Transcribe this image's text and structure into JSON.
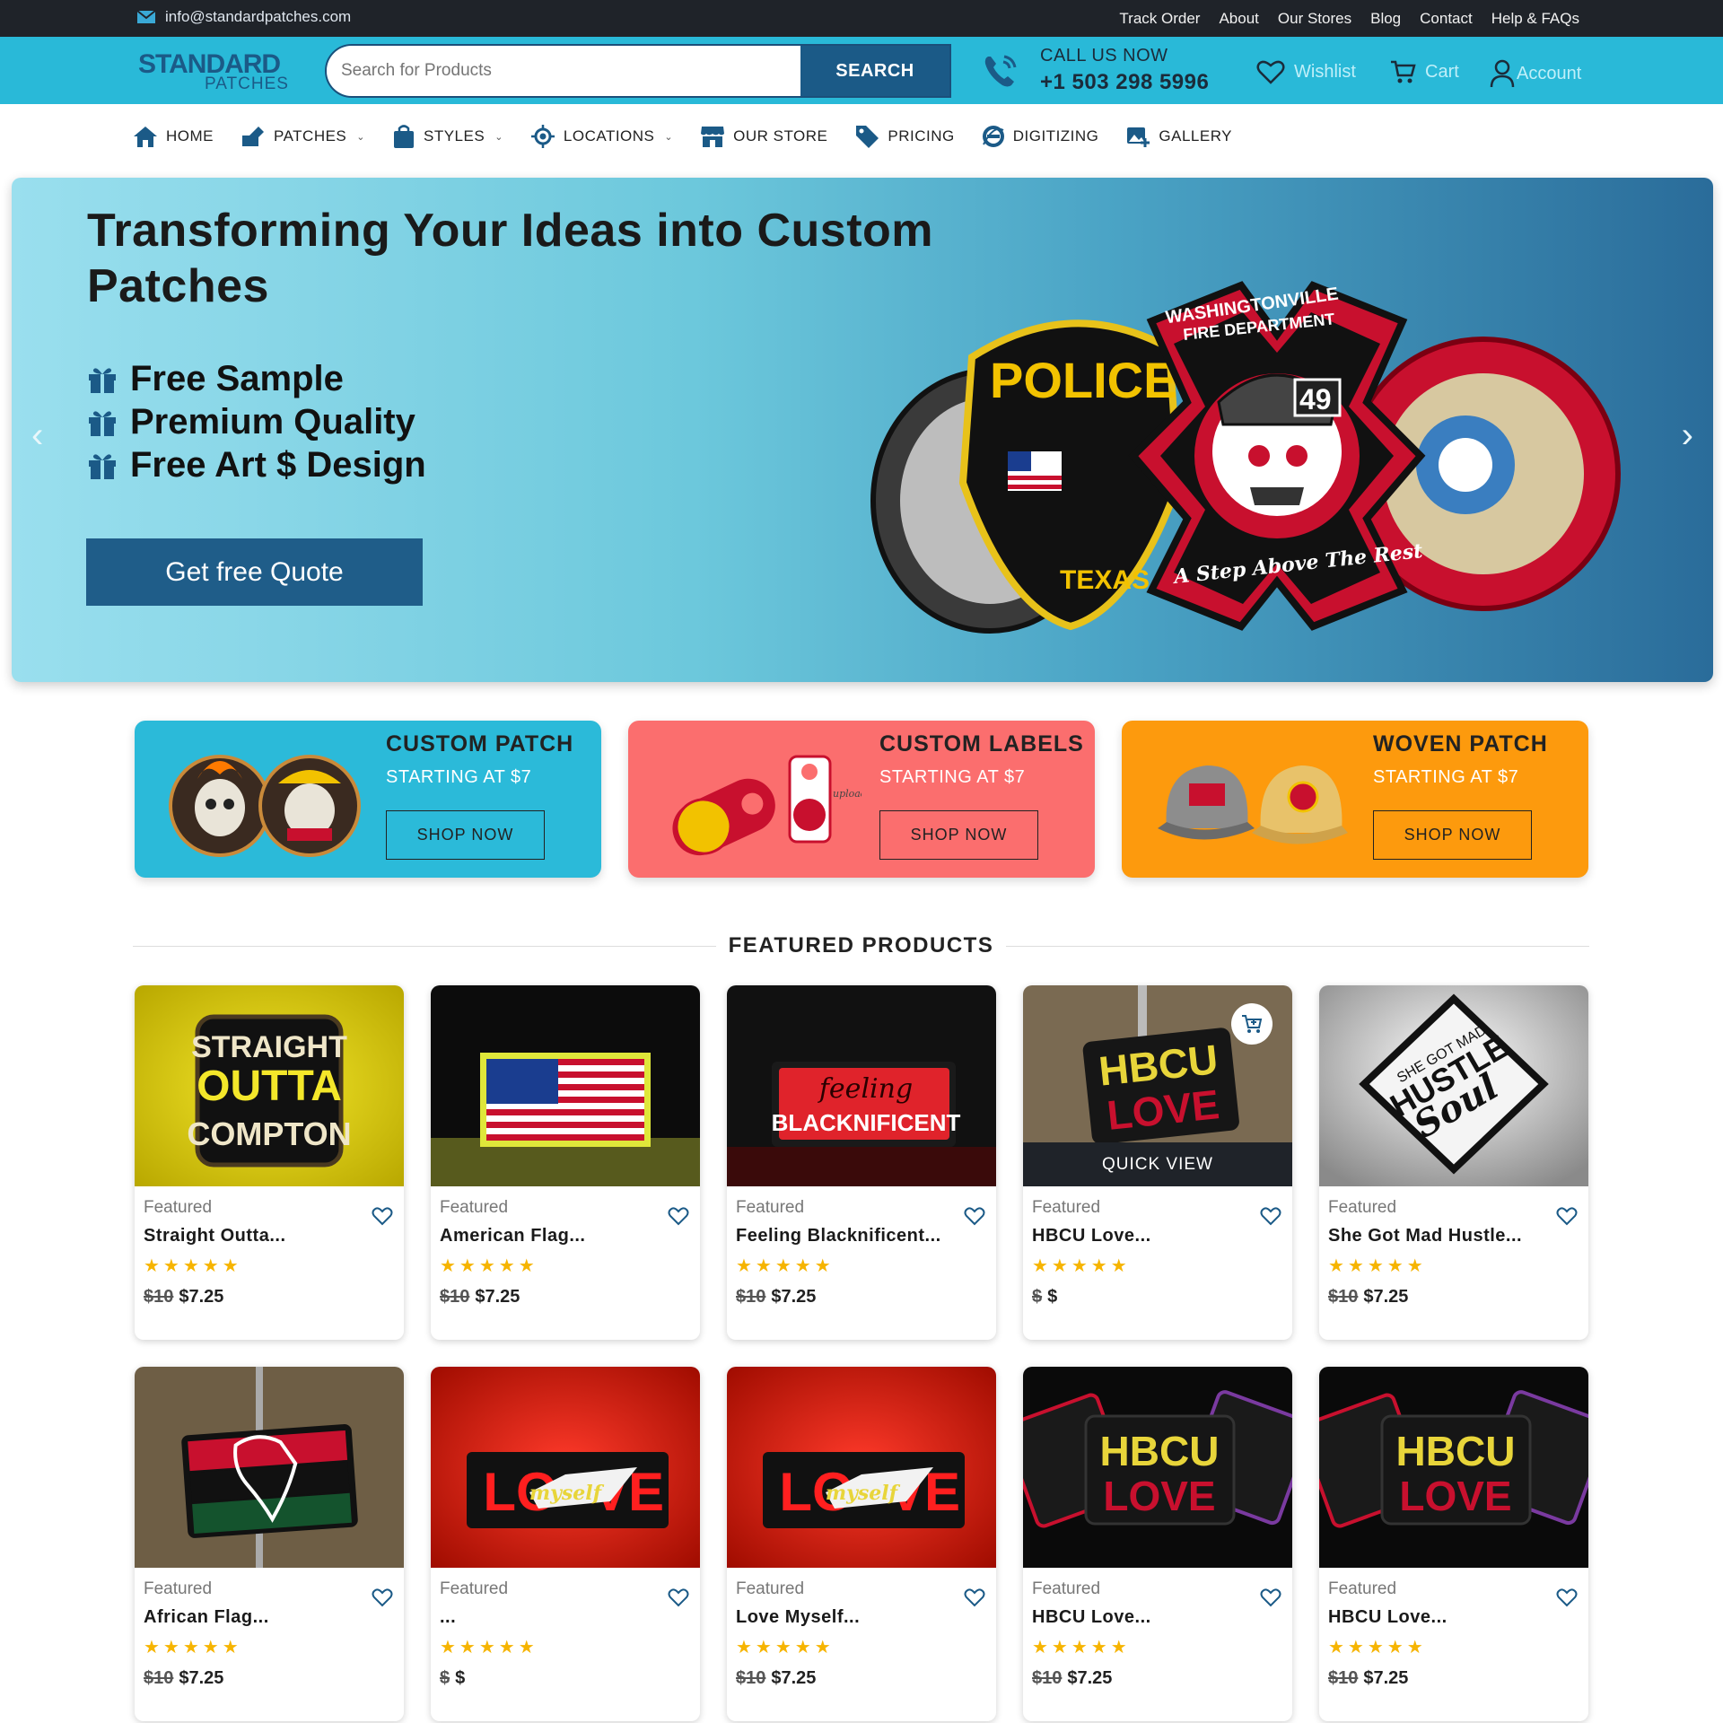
{
  "topbar": {
    "email": "info@standardpatches.com",
    "links": [
      "Track Order",
      "About",
      "Our Stores",
      "Blog",
      "Contact",
      "Help & FAQs"
    ]
  },
  "header": {
    "logo_line1": "STANDARD",
    "logo_line2": "PATCHES",
    "search_placeholder": "Search for Products",
    "search_button": "SEARCH",
    "call_label": "CALL US NOW",
    "phone": "+1 503 298 5996",
    "wishlist": "Wishlist",
    "cart": "Cart",
    "account": "Account"
  },
  "nav": {
    "items": [
      {
        "label": "HOME",
        "icon": "home-icon"
      },
      {
        "label": "PATCHES",
        "icon": "patch-icon"
      },
      {
        "label": "STYLES",
        "icon": "bag-icon"
      },
      {
        "label": "LOCATIONS",
        "icon": "location-icon"
      },
      {
        "label": "OUR STORE",
        "icon": "store-icon"
      },
      {
        "label": "PRICING",
        "icon": "tag-icon"
      },
      {
        "label": "DIGITIZING",
        "icon": "digitizing-icon"
      },
      {
        "label": "GALLERY",
        "icon": "gallery-icon"
      }
    ]
  },
  "hero": {
    "title": "Transforming Your Ideas into Custom Patches",
    "features": [
      "Free Sample",
      "Premium Quality",
      "Free Art $ Design"
    ],
    "cta": "Get free Quote",
    "patch_texts": {
      "police": "POLICE",
      "fire_top": "WASHINGTONVILLE",
      "fire_mid": "FIRE DEPARTMENT",
      "fire_num": "49",
      "fire_bottom": "A Step Above The Rest",
      "texas": "TEXAS"
    }
  },
  "promos": [
    {
      "title": "CUSTOM PATCH",
      "sub": "STARTING AT $7",
      "button": "SHOP NOW",
      "color": "#2bbad9"
    },
    {
      "title": "CUSTOM LABELS",
      "sub": "STARTING AT $7",
      "button": "SHOP NOW",
      "color": "#fb6e6e"
    },
    {
      "title": "WOVEN PATCH",
      "sub": "STARTING AT $7",
      "button": "SHOP NOW",
      "color": "#fd9a0d"
    }
  ],
  "featured": {
    "heading": "FEATURED PRODUCTS",
    "quick_view": "QUICK VIEW",
    "products": [
      {
        "category": "Featured",
        "name": "Straight Outta...",
        "stars": "★★★★★",
        "old_price": "$10",
        "price": "$7.25"
      },
      {
        "category": "Featured",
        "name": "American Flag...",
        "stars": "★★★★★",
        "old_price": "$10",
        "price": "$7.25"
      },
      {
        "category": "Featured",
        "name": "Feeling Blacknificent...",
        "stars": "★★★★★",
        "old_price": "$10",
        "price": "$7.25"
      },
      {
        "category": "Featured",
        "name": "HBCU Love...",
        "stars": "★★★★★",
        "old_price": "$",
        "price": "$"
      },
      {
        "category": "Featured",
        "name": "She Got Mad Hustle...",
        "stars": "★★★★★",
        "old_price": "$10",
        "price": "$7.25"
      },
      {
        "category": "Featured",
        "name": "African Flag...",
        "stars": "★★★★★",
        "old_price": "$10",
        "price": "$7.25"
      },
      {
        "category": "Featured",
        "name": "...",
        "stars": "★★★★★",
        "old_price": "$",
        "price": "$"
      },
      {
        "category": "Featured",
        "name": "Love Myself...",
        "stars": "★★★★★",
        "old_price": "$10",
        "price": "$7.25"
      },
      {
        "category": "Featured",
        "name": "HBCU Love...",
        "stars": "★★★★★",
        "old_price": "$10",
        "price": "$7.25"
      },
      {
        "category": "Featured",
        "name": "HBCU Love...",
        "stars": "★★★★★",
        "old_price": "$10",
        "price": "$7.25"
      }
    ],
    "patch_art": {
      "straight_1": "STRAIGHT",
      "straight_2": "OUTTA",
      "straight_3": "COMPTON",
      "feeling": "feeling",
      "blacknificent": "BLACKNIFICENT",
      "hbcu": "HBCU",
      "love": "LOVE",
      "hustle_1": "SHE GOT MAD",
      "hustle_2": "HUSTLE",
      "hustle_3": "Soul",
      "love_l": "LO",
      "love_v": "VE",
      "myself": "myself"
    }
  }
}
